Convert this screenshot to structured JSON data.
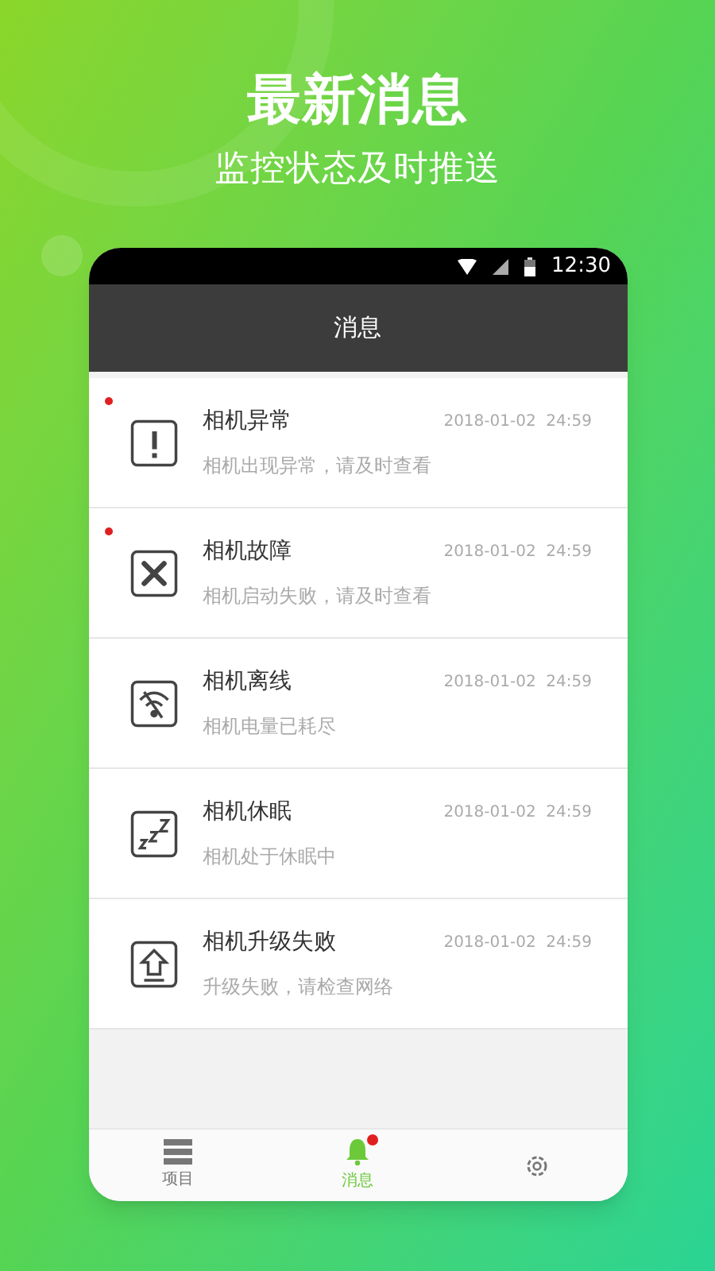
{
  "promo": {
    "title": "最新消息",
    "subtitle": "监控状态及时推送"
  },
  "status_bar": {
    "time": "12:30"
  },
  "header": {
    "title": "消息"
  },
  "messages": [
    {
      "kind": "alert",
      "title": "相机异常",
      "time": "2018-01-02  24:59",
      "text": "相机出现异常，请及时查看",
      "unread": true
    },
    {
      "kind": "repair",
      "title": "相机故障",
      "time": "2018-01-02  24:59",
      "text": "相机启动失败，请及时查看",
      "unread": true
    },
    {
      "kind": "offline",
      "title": "相机离线",
      "time": "2018-01-02  24:59",
      "text": "相机电量已耗尽",
      "unread": false
    },
    {
      "kind": "sleep",
      "title": "相机休眠",
      "time": "2018-01-02  24:59",
      "text": "相机处于休眠中",
      "unread": false
    },
    {
      "kind": "upgrade",
      "title": "相机升级失败",
      "time": "2018-01-02  24:59",
      "text": "升级失败，请检查网络",
      "unread": false
    }
  ],
  "tabs": [
    {
      "kind": "list",
      "label": "项目",
      "selected": false,
      "dot": false
    },
    {
      "kind": "bell",
      "label": "消息",
      "selected": true,
      "dot": true
    },
    {
      "kind": "gear",
      "selected": false,
      "dot": false
    }
  ]
}
